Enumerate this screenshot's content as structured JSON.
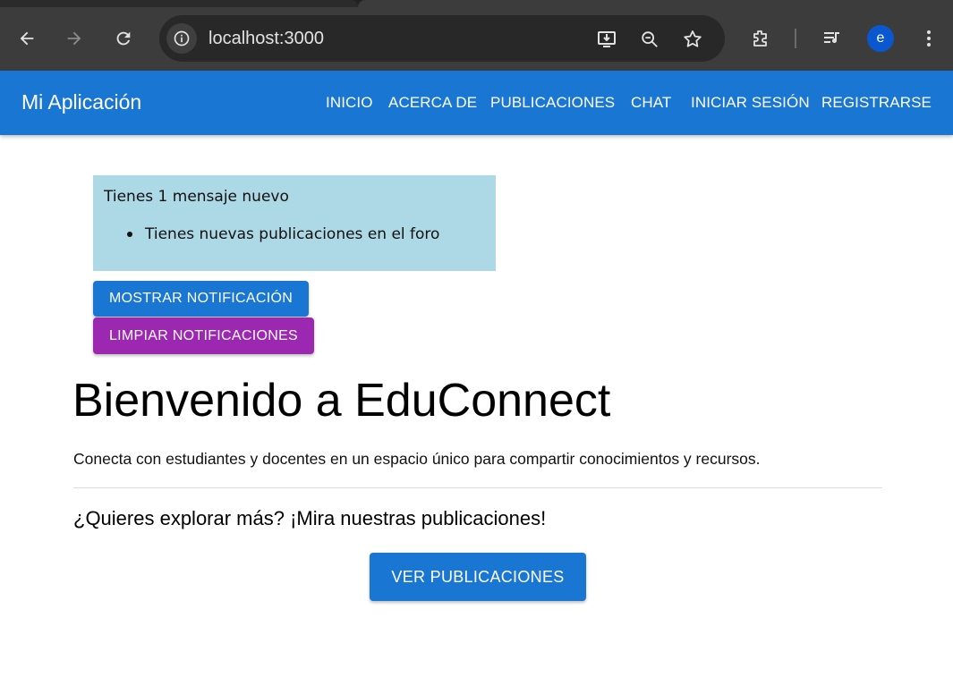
{
  "browser": {
    "url": "localhost:3000",
    "profile_initial": "e",
    "icons": [
      "back-icon",
      "forward-icon",
      "reload-icon",
      "site-info-icon",
      "install-app-icon",
      "zoom-icon",
      "bookmark-star-icon",
      "extensions-icon",
      "media-control-icon",
      "menu-dots-icon"
    ]
  },
  "appbar": {
    "title": "Mi Aplicación",
    "nav": [
      "INICIO",
      "ACERCA DE",
      "PUBLICACIONES",
      "CHAT",
      "INICIAR SESIÓN",
      "REGISTRARSE"
    ],
    "color": "#1976d2"
  },
  "notifications": {
    "title": "Tienes 1 mensaje nuevo",
    "items": [
      "Tienes nuevas publicaciones en el foro"
    ],
    "background": "#add8e6"
  },
  "buttons": {
    "show": "MOSTRAR NOTIFICACIÓN",
    "clear": "LIMPIAR NOTIFICACIONES",
    "posts": "VER PUBLICACIONES"
  },
  "hero": {
    "title": "Bienvenido a EduConnect",
    "subtitle": "Conecta con estudiantes y docentes en un espacio único para compartir conocimientos y recursos.",
    "explore": "¿Quieres explorar más? ¡Mira nuestras publicaciones!"
  }
}
